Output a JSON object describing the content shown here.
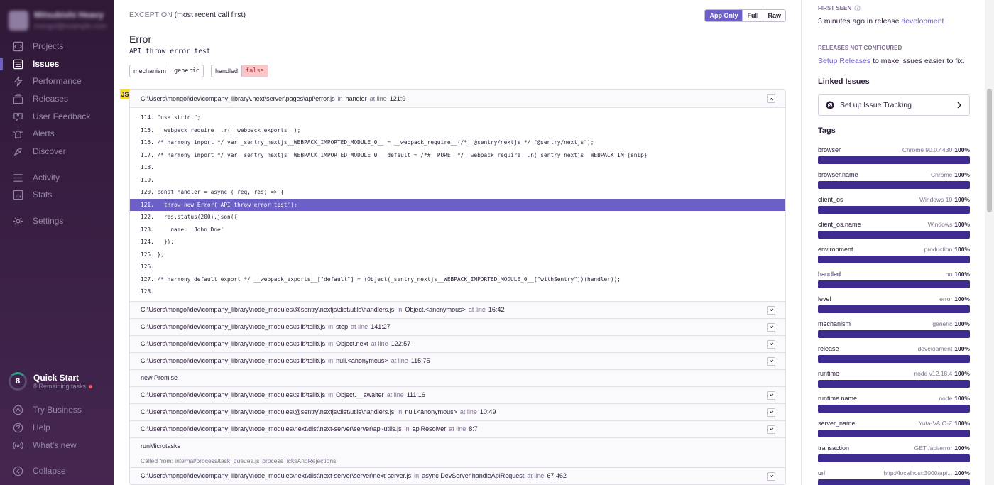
{
  "sidebar": {
    "org_name": "Mitsubishi Heavy",
    "org_user": "mongol@example.com",
    "items": [
      {
        "label": "Projects",
        "icon": "projects-icon"
      },
      {
        "label": "Issues",
        "icon": "issues-icon"
      },
      {
        "label": "Performance",
        "icon": "performance-icon"
      },
      {
        "label": "Releases",
        "icon": "releases-icon"
      },
      {
        "label": "User Feedback",
        "icon": "user-feedback-icon"
      },
      {
        "label": "Alerts",
        "icon": "alerts-icon"
      },
      {
        "label": "Discover",
        "icon": "discover-icon"
      },
      {
        "label": "Activity",
        "icon": "activity-icon"
      },
      {
        "label": "Stats",
        "icon": "stats-icon"
      },
      {
        "label": "Settings",
        "icon": "settings-icon"
      }
    ],
    "active": "Issues",
    "quick_start": {
      "count": "8",
      "title": "Quick Start",
      "subtitle": "8 Remaining tasks"
    },
    "bottom": [
      {
        "label": "Try Business",
        "icon": "business-icon"
      },
      {
        "label": "Help",
        "icon": "help-icon"
      },
      {
        "label": "What's new",
        "icon": "broadcast-icon"
      },
      {
        "label": "Collapse",
        "icon": "collapse-icon"
      }
    ]
  },
  "exception": {
    "heading_key": "EXCEPTION",
    "heading_note": "(most recent call first)",
    "toggle": [
      "App Only",
      "Full",
      "Raw"
    ],
    "type": "Error",
    "value": "API throw error test",
    "mechanism": {
      "key": "mechanism",
      "value": "generic"
    },
    "handled": {
      "key": "handled",
      "value": "false"
    },
    "platform_badge": "JS"
  },
  "frames": [
    {
      "file": "C:\\Users\\mongol\\dev\\company_library\\.next\\server\\pages\\api\\error.js",
      "fn": "handler",
      "line": "121:9",
      "expanded": true
    },
    {
      "file": "C:\\Users\\mongol\\dev\\company_library\\node_modules\\@sentry\\nextjs\\dist\\utils\\handlers.js",
      "fn": "Object.<anonymous>",
      "line": "16:42"
    },
    {
      "file": "C:\\Users\\mongol\\dev\\company_library\\node_modules\\tslib\\tslib.js",
      "fn": "step",
      "line": "141:27"
    },
    {
      "file": "C:\\Users\\mongol\\dev\\company_library\\node_modules\\tslib\\tslib.js",
      "fn": "Object.next",
      "line": "122:57"
    },
    {
      "file": "C:\\Users\\mongol\\dev\\company_library\\node_modules\\tslib\\tslib.js",
      "fn": "null.<anonymous>",
      "line": "115:75"
    },
    {
      "plain": "new Promise"
    },
    {
      "file": "C:\\Users\\mongol\\dev\\company_library\\node_modules\\tslib\\tslib.js",
      "fn": "Object.__awaiter",
      "line": "111:16"
    },
    {
      "file": "C:\\Users\\mongol\\dev\\company_library\\node_modules\\@sentry\\nextjs\\dist\\utils\\handlers.js",
      "fn": "null.<anonymous>",
      "line": "10:49"
    },
    {
      "file": "C:\\Users\\mongol\\dev\\company_library\\node_modules\\next\\dist\\next-server\\server\\api-utils.js",
      "fn": "apiResolver",
      "line": "8:7"
    },
    {
      "plain": "runMicrotasks"
    },
    {
      "called": "Called from: internal/process/task_queues.js",
      "called_fn": "processTicksAndRejections"
    },
    {
      "file": "C:\\Users\\mongol\\dev\\company_library\\node_modules\\next\\dist\\next-server\\server\\next-server.js",
      "fn": "async DevServer.handleApiRequest",
      "line": "67:462"
    }
  ],
  "frame_words": {
    "in": "in",
    "at_line": "at line"
  },
  "code_lines": [
    {
      "n": "114.",
      "t": " \"use strict\";"
    },
    {
      "n": "115.",
      "t": " __webpack_require__.r(__webpack_exports__);"
    },
    {
      "n": "116.",
      "t": " /* harmony import */ var _sentry_nextjs__WEBPACK_IMPORTED_MODULE_0__ = __webpack_require__(/*! @sentry/nextjs */ \"@sentry/nextjs\");"
    },
    {
      "n": "117.",
      "t": " /* harmony import */ var _sentry_nextjs__WEBPACK_IMPORTED_MODULE_0___default = /*#__PURE__*/__webpack_require__.n(_sentry_nextjs__WEBPACK_IM {snip}"
    },
    {
      "n": "118.",
      "t": ""
    },
    {
      "n": "119.",
      "t": ""
    },
    {
      "n": "120.",
      "t": " const handler = async (_req, res) => {"
    },
    {
      "n": "121.",
      "t": "   throw new Error('API throw error test');",
      "hl": true
    },
    {
      "n": "122.",
      "t": "   res.status(200).json({"
    },
    {
      "n": "123.",
      "t": "     name: 'John Doe'"
    },
    {
      "n": "124.",
      "t": "   });"
    },
    {
      "n": "125.",
      "t": " };"
    },
    {
      "n": "126.",
      "t": ""
    },
    {
      "n": "127.",
      "t": " /* harmony default export */ __webpack_exports__[\"default\"] = (Object(_sentry_nextjs__WEBPACK_IMPORTED_MODULE_0__[\"withSentry\"])(handler));"
    },
    {
      "n": "128.",
      "t": ""
    }
  ],
  "right": {
    "first_seen_label": "FIRST SEEN",
    "first_seen_text": "3 minutes ago",
    "first_seen_mid": "in release",
    "first_seen_release": "development",
    "releases_label": "RELEASES NOT CONFIGURED",
    "setup_link": "Setup Releases",
    "setup_rest": "to make issues easier to fix.",
    "linked_issues": "Linked Issues",
    "issue_tracking": "Set up Issue Tracking",
    "tags_heading": "Tags",
    "tags": [
      {
        "key": "browser",
        "value": "Chrome 90.0.4430",
        "pct": "100%"
      },
      {
        "key": "browser.name",
        "value": "Chrome",
        "pct": "100%"
      },
      {
        "key": "client_os",
        "value": "Windows 10",
        "pct": "100%"
      },
      {
        "key": "client_os.name",
        "value": "Windows",
        "pct": "100%"
      },
      {
        "key": "environment",
        "value": "production",
        "pct": "100%"
      },
      {
        "key": "handled",
        "value": "no",
        "pct": "100%"
      },
      {
        "key": "level",
        "value": "error",
        "pct": "100%"
      },
      {
        "key": "mechanism",
        "value": "generic",
        "pct": "100%"
      },
      {
        "key": "release",
        "value": "development",
        "pct": "100%"
      },
      {
        "key": "runtime",
        "value": "node v12.18.4",
        "pct": "100%"
      },
      {
        "key": "runtime.name",
        "value": "node",
        "pct": "100%"
      },
      {
        "key": "server_name",
        "value": "Yuta-VAIO-Z",
        "pct": "100%"
      },
      {
        "key": "transaction",
        "value": "GET /api/error",
        "pct": "100%"
      },
      {
        "key": "url",
        "value": "http://localhost:3000/api...",
        "pct": "100%"
      }
    ]
  },
  "colors": {
    "accent": "#6c5fc7",
    "tag_bar": "#3f2a8f",
    "sidebar_top": "#2f1937",
    "sidebar_bottom": "#452650"
  }
}
